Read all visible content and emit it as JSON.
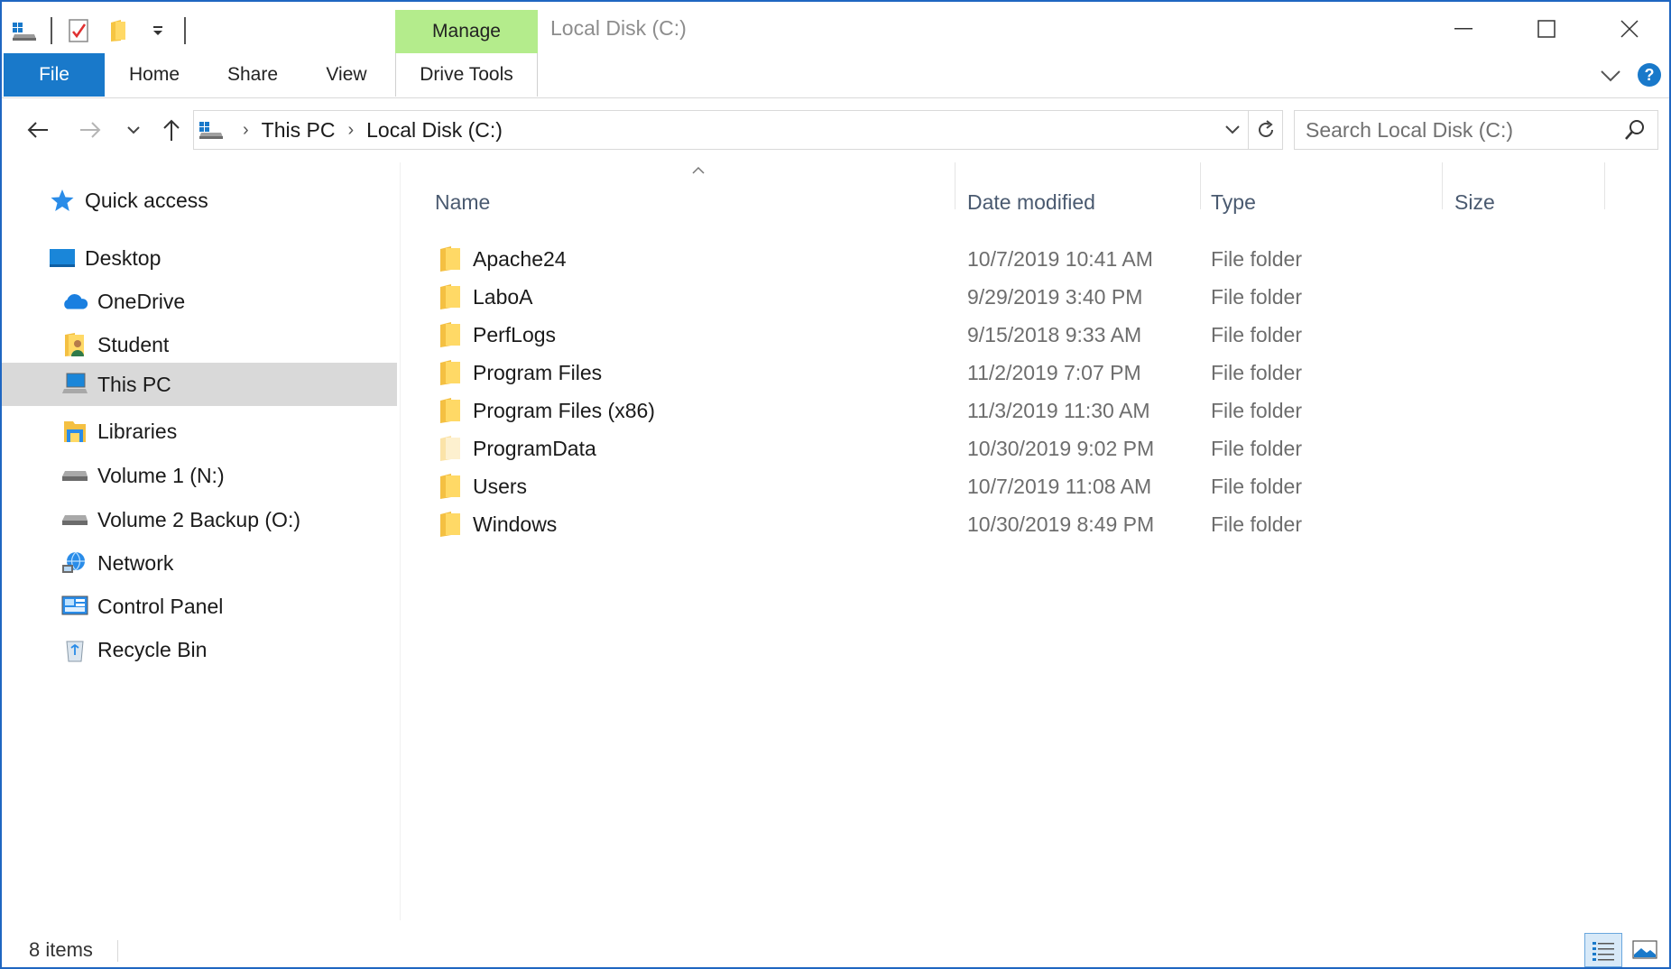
{
  "window": {
    "title": "Local Disk (C:)",
    "contextual_group": "Manage",
    "accent": "#1979ca",
    "manage_color": "#b4ec8c"
  },
  "ribbon": {
    "tabs": [
      {
        "label": "File"
      },
      {
        "label": "Home"
      },
      {
        "label": "Share"
      },
      {
        "label": "View"
      },
      {
        "label": "Drive Tools"
      }
    ]
  },
  "address": {
    "crumbs": [
      "This PC",
      "Local Disk (C:)"
    ]
  },
  "search": {
    "placeholder": "Search Local Disk (C:)"
  },
  "nav": {
    "items": [
      {
        "label": "Quick access",
        "icon": "star-icon"
      },
      {
        "label": "Desktop",
        "icon": "desktop-icon"
      },
      {
        "label": "OneDrive",
        "icon": "cloud-icon"
      },
      {
        "label": "Student",
        "icon": "user-folder-icon"
      },
      {
        "label": "This PC",
        "icon": "computer-icon",
        "selected": true
      },
      {
        "label": "Libraries",
        "icon": "libraries-icon"
      },
      {
        "label": "Volume 1 (N:)",
        "icon": "drive-icon"
      },
      {
        "label": "Volume 2 Backup (O:)",
        "icon": "drive-icon"
      },
      {
        "label": "Network",
        "icon": "network-icon"
      },
      {
        "label": "Control Panel",
        "icon": "control-panel-icon"
      },
      {
        "label": "Recycle Bin",
        "icon": "recycle-bin-icon"
      }
    ]
  },
  "columns": {
    "name": "Name",
    "date": "Date modified",
    "type": "Type",
    "size": "Size"
  },
  "files": [
    {
      "name": "Apache24",
      "date": "10/7/2019 10:41 AM",
      "type": "File folder"
    },
    {
      "name": "LaboA",
      "date": "9/29/2019 3:40 PM",
      "type": "File folder"
    },
    {
      "name": "PerfLogs",
      "date": "9/15/2018 9:33 AM",
      "type": "File folder"
    },
    {
      "name": "Program Files",
      "date": "11/2/2019 7:07 PM",
      "type": "File folder"
    },
    {
      "name": "Program Files (x86)",
      "date": "11/3/2019 11:30 AM",
      "type": "File folder"
    },
    {
      "name": "ProgramData",
      "date": "10/30/2019 9:02 PM",
      "type": "File folder",
      "hidden": true
    },
    {
      "name": "Users",
      "date": "10/7/2019 11:08 AM",
      "type": "File folder"
    },
    {
      "name": "Windows",
      "date": "10/30/2019 8:49 PM",
      "type": "File folder"
    }
  ],
  "status": {
    "count": "8 items"
  }
}
